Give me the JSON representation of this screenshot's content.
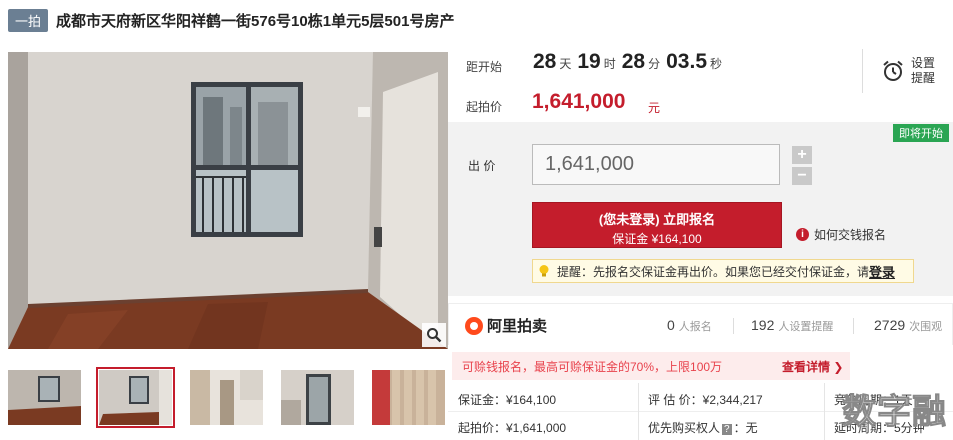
{
  "title": {
    "tag": "一拍",
    "text": "成都市天府新区华阳祥鹤一街576号10栋1单元5层501号房产"
  },
  "countdown": {
    "label": "距开始",
    "days": "28",
    "days_unit": "天",
    "hours": "19",
    "hours_unit": "时",
    "minutes": "28",
    "minutes_unit": "分",
    "seconds": "03.5",
    "seconds_unit": "秒"
  },
  "reminder": {
    "label": "设置提醒",
    "icon": "alarm-clock-icon"
  },
  "start_price": {
    "label": "起拍价",
    "value": "1,641,000",
    "unit": "元"
  },
  "bid": {
    "status_badge": "即将开始",
    "label": "出  价",
    "input_value": "1,641,000",
    "plus": "+",
    "minus": "−",
    "register_main": "(您未登录) 立即报名",
    "register_sub": "保证金 ¥164,100",
    "howto": "如何交钱报名",
    "tip_text": "提醒：先报名交保证金再出价。如果您已经交付保证金，请",
    "tip_link": "登录"
  },
  "stats": {
    "brand": "阿里拍卖",
    "signups": "0",
    "signups_label": "人报名",
    "reminders": "192",
    "reminders_label": "人设置提醒",
    "watchers": "2729",
    "watchers_label": "次围观"
  },
  "notice": {
    "text": "可赊钱报名，最高可赊保证金的70%，上限100万",
    "link": "查看详情 ❯"
  },
  "details": {
    "deposit": "保证金：¥164,100",
    "appraisal": "评 估 价：¥2,344,217",
    "bid_cycle": "竞价周期：1天",
    "start_price": "起拍价：¥1,641,000",
    "priority_prefix": "优先购买权人",
    "priority_icon": "?",
    "priority_suffix": "：无",
    "delay_cycle": "延时周期：5分钟"
  },
  "watermark": "数字融",
  "colors": {
    "accent_red": "#c41d2c",
    "tag_gray": "#6b7f93",
    "badge_green": "#2aa553",
    "notice_bg": "#fdecec"
  }
}
